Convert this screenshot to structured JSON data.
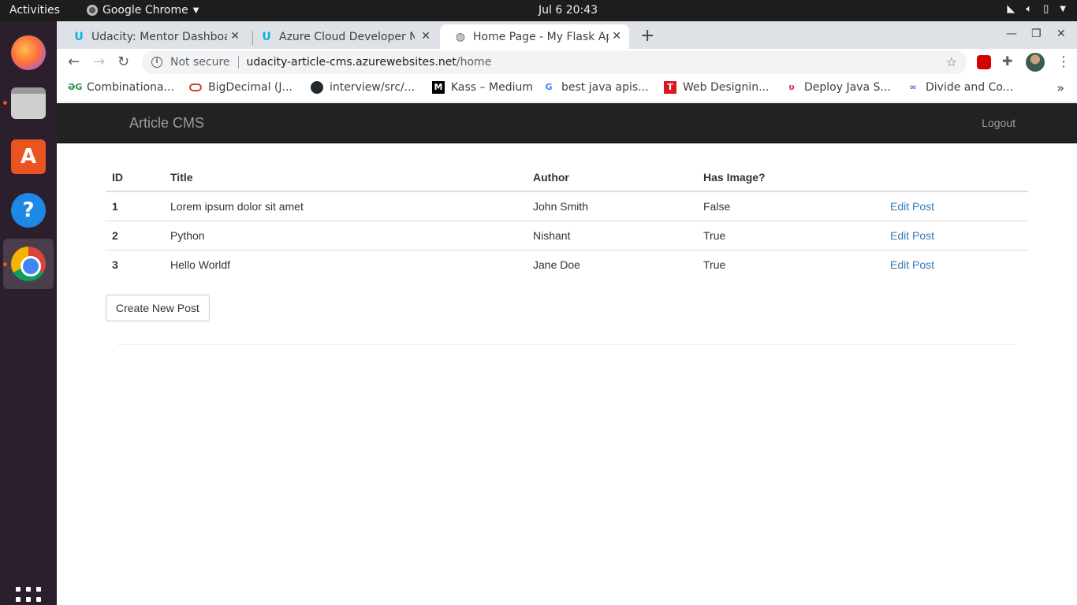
{
  "system": {
    "activities": "Activities",
    "app_name": "Google Chrome",
    "clock": "Jul 6  20:43"
  },
  "browser": {
    "tabs": [
      {
        "title": "Udacity: Mentor Dashboard",
        "active": false
      },
      {
        "title": "Azure Cloud Developer Na",
        "active": false
      },
      {
        "title": "Home Page - My Flask App",
        "active": true
      }
    ],
    "address": {
      "security": "Not secure",
      "host": "udacity-article-cms.azurewebsites.net",
      "path": "/home"
    },
    "bookmarks": [
      {
        "label": "Combinationa...",
        "icon": "geeksforgeeks-icon"
      },
      {
        "label": "BigDecimal (J...",
        "icon": "oracle-icon"
      },
      {
        "label": "interview/src/...",
        "icon": "github-icon"
      },
      {
        "label": "Kass – Medium",
        "icon": "medium-icon"
      },
      {
        "label": "best java apis...",
        "icon": "google-icon"
      },
      {
        "label": "Web Designin...",
        "icon": "tutorialspoint-icon"
      },
      {
        "label": "Deploy Java S...",
        "icon": "dzone-icon"
      },
      {
        "label": "Divide and Co...",
        "icon": "link-icon"
      }
    ]
  },
  "page": {
    "brand": "Article CMS",
    "logout": "Logout",
    "table": {
      "headers": [
        "ID",
        "Title",
        "Author",
        "Has Image?",
        ""
      ],
      "rows": [
        {
          "id": "1",
          "title": "Lorem ipsum dolor sit amet",
          "author": "John Smith",
          "has_image": "False",
          "action": "Edit Post"
        },
        {
          "id": "2",
          "title": "Python",
          "author": "Nishant",
          "has_image": "True",
          "action": "Edit Post"
        },
        {
          "id": "3",
          "title": "Hello Worldf",
          "author": "Jane Doe",
          "has_image": "True",
          "action": "Edit Post"
        }
      ]
    },
    "create_button": "Create New Post"
  },
  "colors": {
    "navbar_bg": "#222222",
    "link": "#337ab7",
    "ubuntu_dock": "#2b1f2e",
    "topbar": "#1d1d1d"
  }
}
